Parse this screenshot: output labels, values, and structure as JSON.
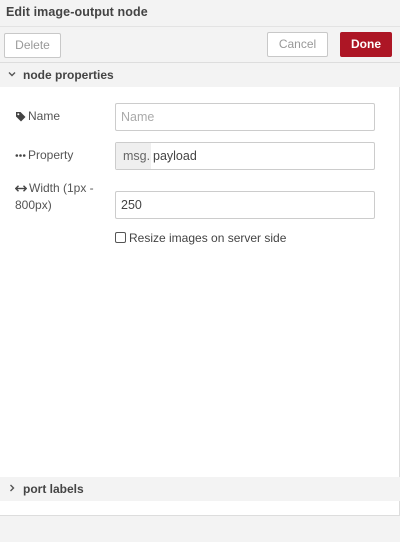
{
  "header": {
    "title": "Edit image-output node"
  },
  "toolbar": {
    "delete_label": "Delete",
    "cancel_label": "Cancel",
    "done_label": "Done"
  },
  "sections": {
    "node_properties": "node properties",
    "port_labels": "port labels"
  },
  "form": {
    "name": {
      "label": "Name",
      "placeholder": "Name",
      "value": ""
    },
    "property": {
      "label": "Property",
      "prefix": "msg.",
      "value": "payload"
    },
    "width": {
      "label": "Width (1px - 800px)",
      "value": "250"
    },
    "resize": {
      "label": "Resize images on server side",
      "checked": false
    }
  },
  "icons": {
    "name": "tag-icon",
    "property": "ellipsis-icon",
    "width": "arrows-h-icon",
    "expanded": "chevron-down-icon",
    "collapsed": "chevron-right-icon"
  },
  "colors": {
    "primary": "#ad1625",
    "header_bg": "#f3f3f3"
  }
}
